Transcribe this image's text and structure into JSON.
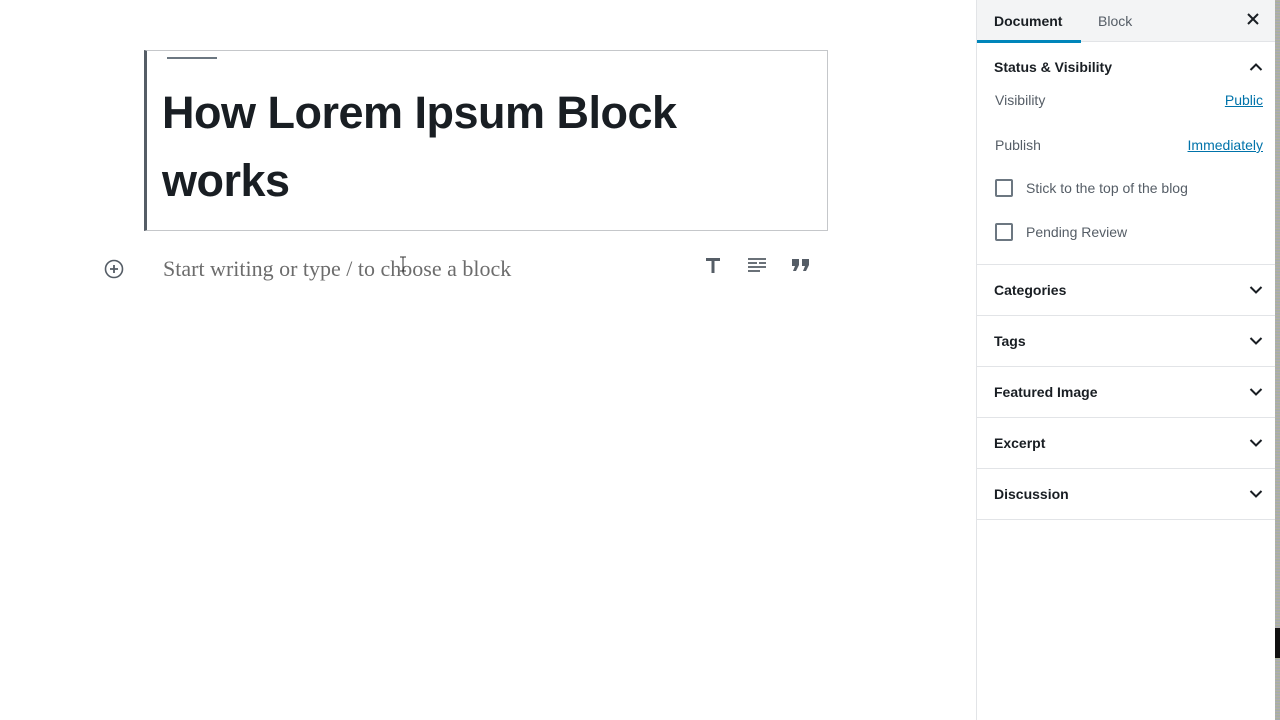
{
  "editor": {
    "post_title": "How Lorem Ipsum Block works",
    "block_placeholder": "Start writing or type / to choose a block",
    "inserter_icon": "plus-circle-icon",
    "quick_tools": [
      {
        "name": "heading",
        "icon": "heading-T-icon"
      },
      {
        "name": "paragraph",
        "icon": "paragraph-lines-icon"
      },
      {
        "name": "quote",
        "icon": "quote-icon"
      }
    ]
  },
  "sidebar": {
    "tabs": [
      {
        "label": "Document",
        "active": true
      },
      {
        "label": "Block",
        "active": false
      }
    ],
    "close_icon": "close-icon",
    "status_panel": {
      "title": "Status & Visibility",
      "expanded": true,
      "visibility_label": "Visibility",
      "visibility_value": "Public",
      "publish_label": "Publish",
      "publish_value": "Immediately",
      "sticky_label": "Stick to the top of the blog",
      "sticky_checked": false,
      "pending_label": "Pending Review",
      "pending_checked": false
    },
    "panels": [
      {
        "title": "Categories"
      },
      {
        "title": "Tags"
      },
      {
        "title": "Featured Image"
      },
      {
        "title": "Excerpt"
      },
      {
        "title": "Discussion"
      }
    ]
  },
  "colors": {
    "accent": "#0085ba",
    "link": "#0073aa",
    "text": "#191e23"
  }
}
